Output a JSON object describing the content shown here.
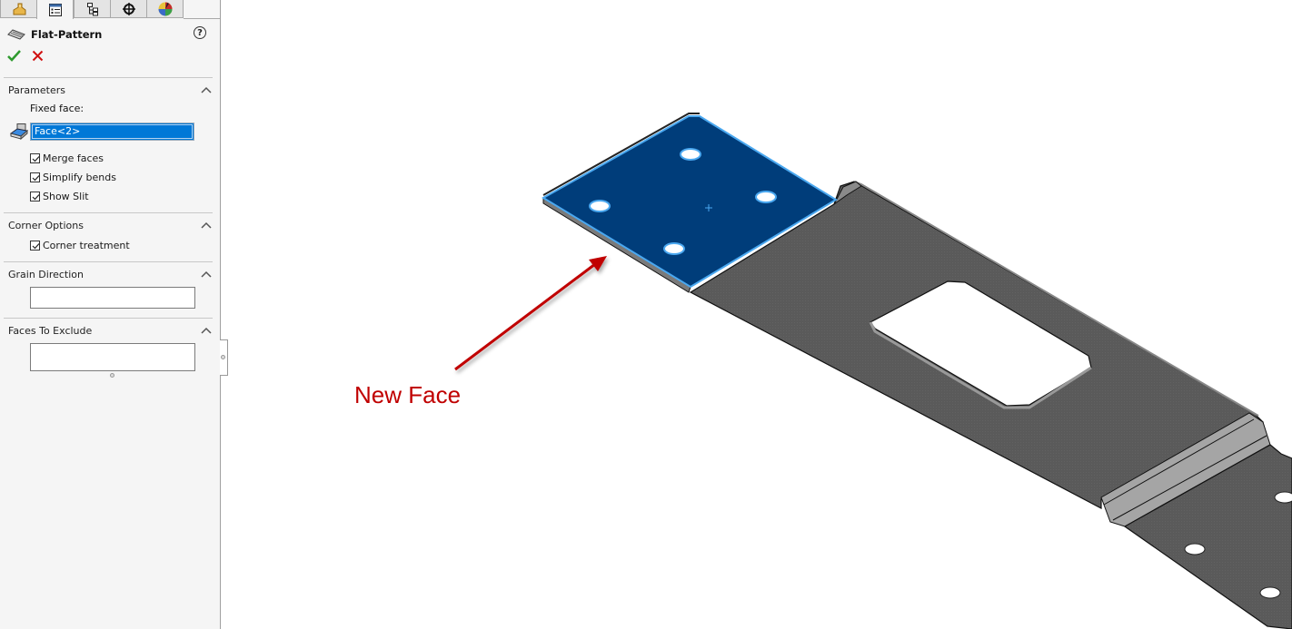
{
  "panel": {
    "tabs": [
      {
        "icon": "feature-manager-icon",
        "active": false
      },
      {
        "icon": "property-manager-icon",
        "active": true
      },
      {
        "icon": "configuration-manager-icon",
        "active": false
      },
      {
        "icon": "dimxpert-manager-icon",
        "active": false
      },
      {
        "icon": "display-manager-icon",
        "active": false
      }
    ],
    "title": "Flat-Pattern",
    "help_icon": "?",
    "ok_icon": "checkmark-icon",
    "cancel_icon": "close-icon",
    "sections": {
      "parameters": {
        "title": "Parameters",
        "fixed_face_label": "Fixed face:",
        "fixed_face_value": "Face<2>",
        "checkboxes": [
          {
            "label": "Merge faces",
            "checked": true
          },
          {
            "label": "Simplify bends",
            "checked": true
          },
          {
            "label": "Show Slit",
            "checked": true
          }
        ]
      },
      "corner_options": {
        "title": "Corner Options",
        "checkboxes": [
          {
            "label": "Corner treatment",
            "checked": true
          }
        ]
      },
      "grain_direction": {
        "title": "Grain Direction",
        "value": ""
      },
      "faces_to_exclude": {
        "title": "Faces To Exclude",
        "value": ""
      }
    }
  },
  "viewport": {
    "annotation": "New Face",
    "colors": {
      "selected_face": "#003d7a",
      "selected_edge": "#4aa8f0",
      "part_body": "#5a5a5a",
      "annotation": "#c00000"
    }
  }
}
